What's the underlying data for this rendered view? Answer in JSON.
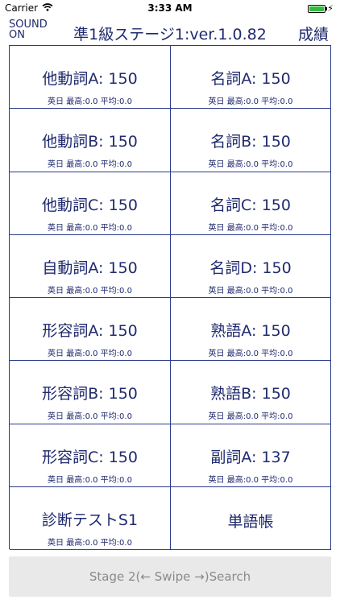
{
  "status": {
    "carrier": "Carrier",
    "time": "3:33 AM"
  },
  "nav": {
    "sound_line1": "SOUND",
    "sound_line2": "ON",
    "title": "準1級ステージ1:ver.1.0.82",
    "grades": "成績"
  },
  "cells": [
    {
      "title": "他動詞A: 150",
      "sub": "英日 最高:0.0 平均:0.0"
    },
    {
      "title": "名詞A: 150",
      "sub": "英日 最高:0.0 平均:0.0"
    },
    {
      "title": "他動詞B: 150",
      "sub": "英日 最高:0.0 平均:0.0"
    },
    {
      "title": "名詞B: 150",
      "sub": "英日 最高:0.0 平均:0.0"
    },
    {
      "title": "他動詞C: 150",
      "sub": "英日 最高:0.0 平均:0.0"
    },
    {
      "title": "名詞C: 150",
      "sub": "英日 最高:0.0 平均:0.0"
    },
    {
      "title": "自動詞A: 150",
      "sub": "英日 最高:0.0 平均:0.0"
    },
    {
      "title": "名詞D: 150",
      "sub": "英日 最高:0.0 平均:0.0"
    },
    {
      "title": "形容詞A: 150",
      "sub": "英日 最高:0.0 平均:0.0"
    },
    {
      "title": "熟語A: 150",
      "sub": "英日 最高:0.0 平均:0.0"
    },
    {
      "title": "形容詞B: 150",
      "sub": "英日 最高:0.0 平均:0.0"
    },
    {
      "title": "熟語B: 150",
      "sub": "英日 最高:0.0 平均:0.0"
    },
    {
      "title": "形容詞C: 150",
      "sub": "英日 最高:0.0 平均:0.0"
    },
    {
      "title": "副詞A: 137",
      "sub": "英日 最高:0.0 平均:0.0"
    },
    {
      "title": "診断テストS1",
      "sub": "英日 最高:0.0 平均:0.0"
    },
    {
      "title": "単語帳",
      "sub": ""
    }
  ],
  "bottom": {
    "label": "Stage 2(← Swipe →)Search"
  }
}
